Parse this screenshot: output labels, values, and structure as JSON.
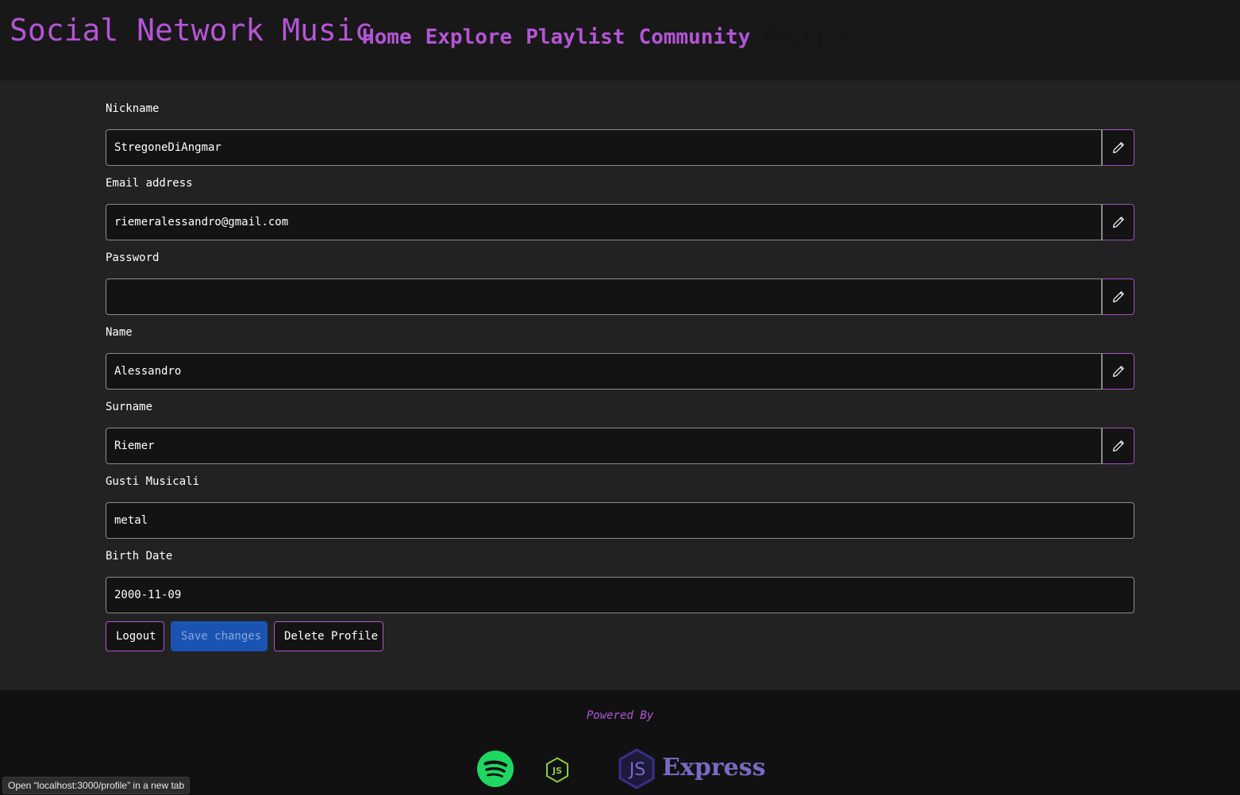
{
  "navbar": {
    "brand": "Social Network Music",
    "links": [
      {
        "label": "Home"
      },
      {
        "label": "Explore"
      },
      {
        "label": "Playlist"
      },
      {
        "label": "Community"
      },
      {
        "label": "Profile",
        "active": true
      }
    ]
  },
  "form": {
    "nickname": {
      "label": "Nickname",
      "value": "StregoneDiAngmar"
    },
    "email": {
      "label": "Email address",
      "value": "riemeralessandro@gmail.com"
    },
    "password": {
      "label": "Password",
      "value": ""
    },
    "name": {
      "label": "Name",
      "value": "Alessandro"
    },
    "surname": {
      "label": "Surname",
      "value": "Riemer"
    },
    "gusti": {
      "label": "Gusti Musicali",
      "value": "metal"
    },
    "birth_date": {
      "label": "Birth Date",
      "value": "2000-11-09"
    }
  },
  "actions": {
    "logout": "Logout",
    "save": "Save changes",
    "delete": "Delete Profile"
  },
  "footer": {
    "powered_by": "Powered By",
    "logos": [
      "spotify-logo",
      "nodejs-logo",
      "express-logo"
    ],
    "express_text": "Express"
  },
  "status_bar": {
    "text": "Open “localhost:3000/profile” in a new tab"
  },
  "colors": {
    "accent": "#b455d6",
    "primary_button": "#1b53b2",
    "spotify": "#1ed760",
    "node": "#8cc84b",
    "express": "#7a6ac4"
  }
}
